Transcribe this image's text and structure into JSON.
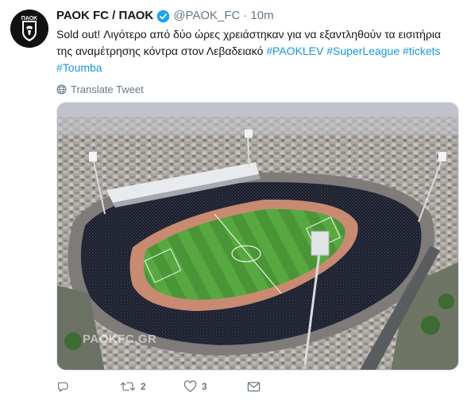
{
  "tweet": {
    "display_name": "ΡΑΟΚ FC / ΠΑΟΚ",
    "handle": "@PAOK_FC",
    "separator": "·",
    "time": "10m",
    "text_intro": "Sold out! Λιγότερο από δύο ώρες χρειάστηκαν για να εξαντληθούν τα εισιτήρια της αναμέτρησης κόντρα στον Λεβαδειακό ",
    "hashtags": [
      "#PAOKLEV",
      "#SuperLeague",
      "#tickets",
      "#Toumba"
    ],
    "translate_label": "Translate Tweet",
    "avatar_text": "ΠΑΟΚ",
    "media_watermark": "PAOKFC.GR",
    "reply_count": "",
    "retweet_count": "2",
    "like_count": "3"
  },
  "icons": {
    "verified": "verified-badge-icon",
    "globe": "globe-icon",
    "reply": "reply-icon",
    "retweet": "retweet-icon",
    "like": "heart-icon",
    "dm": "envelope-icon"
  },
  "colors": {
    "link": "#1b95e0",
    "secondary_text": "#657786",
    "verified": "#1da1f2"
  }
}
